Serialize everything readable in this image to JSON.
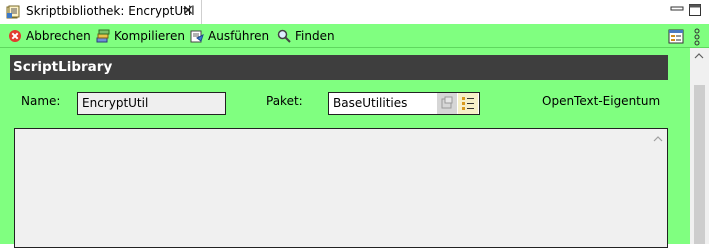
{
  "tab": {
    "title": "Skriptbibliothek: EncryptUtil",
    "close_glyph": "✕"
  },
  "toolbar": {
    "cancel_label": "Abbrechen",
    "compile_label": "Kompilieren",
    "run_label": "Ausführen",
    "find_label": "Finden"
  },
  "section": {
    "title": "ScriptLibrary"
  },
  "form": {
    "name_label": "Name:",
    "name_value": "EncryptUtil",
    "package_label": "Paket:",
    "package_value": "BaseUtilities",
    "ownership_text": "OpenText-Eigentum"
  },
  "colors": {
    "editor_background": "#80ff80",
    "header_background": "#3e3e3e",
    "cancel_icon": "#e23b2e"
  },
  "icons": {
    "tab": "script-library-icon",
    "cancel": "cancel-icon",
    "compile": "compile-icon",
    "run": "run-icon",
    "find": "magnifier-icon",
    "package_open": "package-open-icon",
    "package_browse": "package-browse-icon",
    "toolbar_right": "outline-view-icon",
    "toolbar_menu": "view-menu-icon"
  }
}
